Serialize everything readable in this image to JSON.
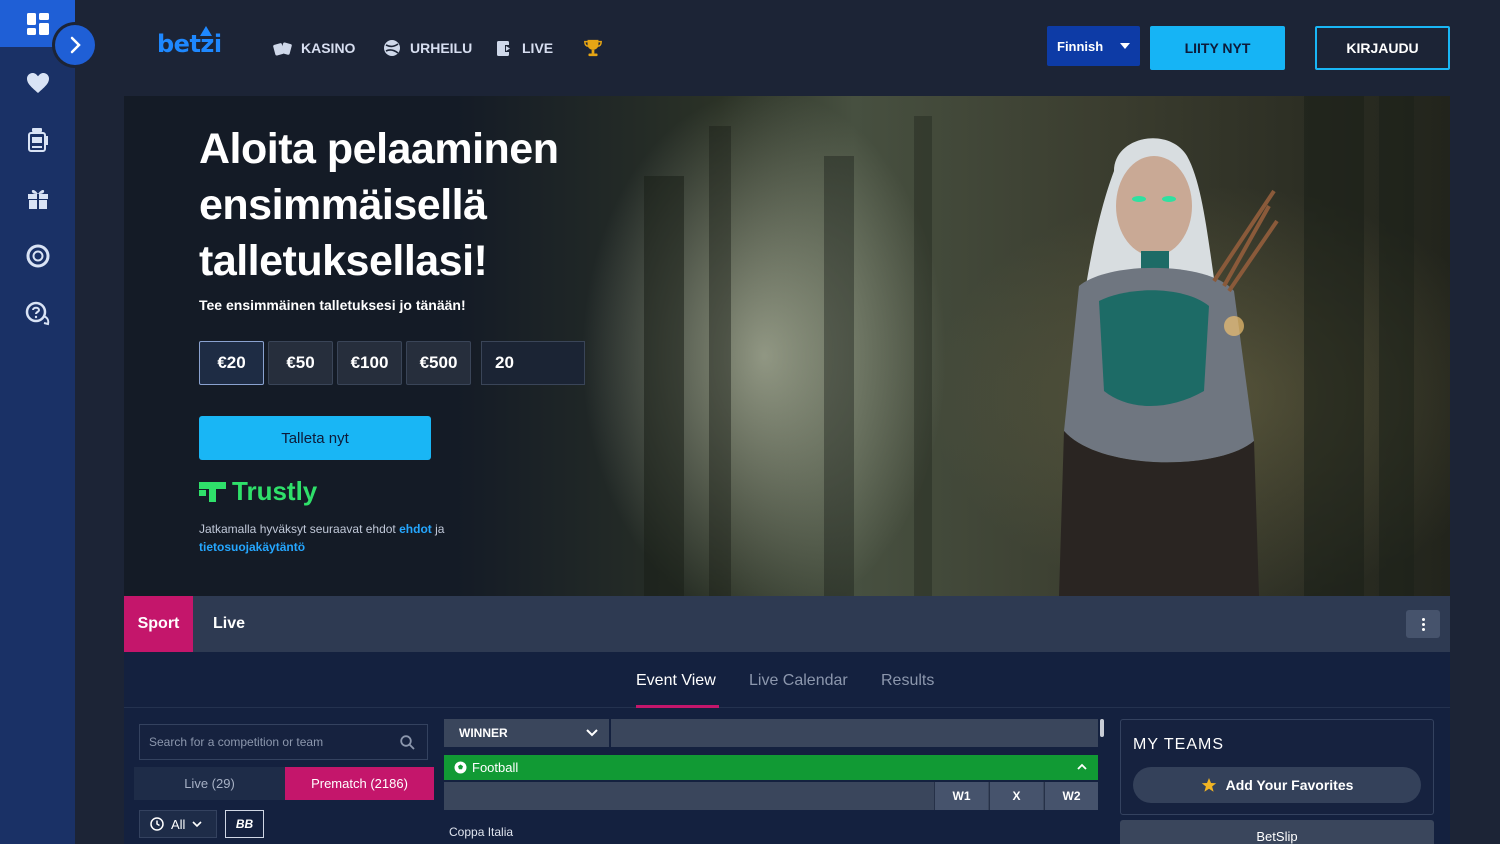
{
  "brand": {
    "logo_text": "betzi",
    "accent": "#19b6f5",
    "primary": "#1f5fd6",
    "pink": "#c4166b",
    "green": "#119a34"
  },
  "rail": {
    "items": [
      {
        "icon": "grid-icon"
      },
      {
        "icon": "chevron-right-icon"
      },
      {
        "icon": "heart-icon"
      },
      {
        "icon": "slot-machine-icon"
      },
      {
        "icon": "gift-icon"
      },
      {
        "icon": "lifebuoy-icon"
      },
      {
        "icon": "help-chat-icon"
      }
    ]
  },
  "nav": {
    "items": [
      {
        "label": "KASINO",
        "icon": "cards-icon"
      },
      {
        "label": "URHEILU",
        "icon": "ball-icon"
      },
      {
        "label": "LIVE",
        "icon": "live-icon"
      },
      {
        "label": "",
        "icon": "trophy-icon"
      }
    ],
    "language": "Finnish",
    "join_label": "LIITY NYT",
    "login_label": "KIRJAUDU"
  },
  "hero": {
    "title_lines": [
      "Aloita pelaaminen",
      "ensimmäisellä",
      "talletuksellasi!"
    ],
    "subtitle": "Tee ensimmäinen talletuksesi jo tänään!",
    "amounts": [
      "€20",
      "€50",
      "€100",
      "€500"
    ],
    "selected_amount": "€20",
    "amount_input_value": "20",
    "deposit_label": "Talleta nyt",
    "payment_brand": "Trustly",
    "terms_prefix": "Jatkamalla hyväksyt seuraavat ehdot",
    "terms_link": "ehdot",
    "terms_join": "ja",
    "privacy_link": "tietosuojakäytäntö"
  },
  "sportbar": {
    "sport_tab": "Sport",
    "live_tab": "Live"
  },
  "view_tabs": {
    "event_view": "Event View",
    "live_calendar": "Live Calendar",
    "results": "Results"
  },
  "sidebar": {
    "search_placeholder": "Search for a competition or team",
    "live_label": "Live (29)",
    "prematch_label": "Prematch (2186)",
    "filter_all": "All",
    "filter_bb": "BB"
  },
  "markets": {
    "market_select": "WINNER",
    "sport_header": "Football",
    "odds_columns": [
      "W1",
      "X",
      "W2"
    ],
    "competition": "Coppa Italia"
  },
  "right_panel": {
    "my_teams_title": "MY TEAMS",
    "add_favorites": "Add Your Favorites",
    "betslip": "BetSlip"
  }
}
